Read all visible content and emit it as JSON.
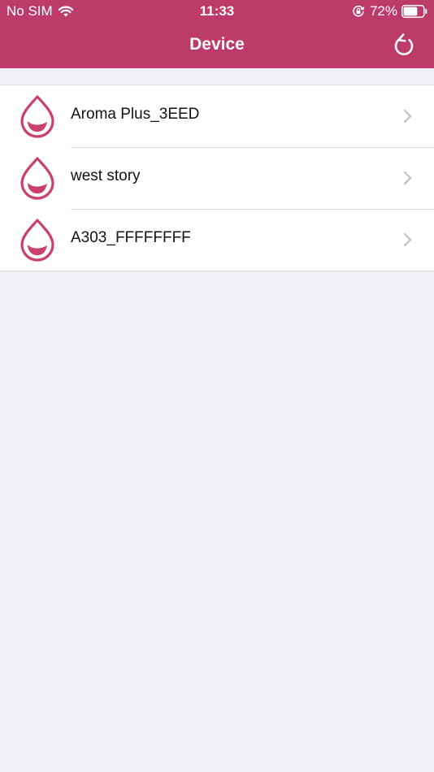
{
  "status_bar": {
    "carrier": "No SIM",
    "time": "11:33",
    "battery_percent": "72%",
    "battery_level": 0.72,
    "icons": [
      "wifi-icon",
      "orientation-lock-icon",
      "battery-icon"
    ]
  },
  "nav": {
    "title": "Device",
    "refresh_icon": "refresh-icon"
  },
  "devices": [
    {
      "name": "Aroma Plus_3EED",
      "icon": "drop-icon"
    },
    {
      "name": "west story",
      "icon": "drop-icon"
    },
    {
      "name": "A303_FFFFFFFF",
      "icon": "drop-icon"
    }
  ],
  "colors": {
    "brand": "#bd3b68",
    "background": "#f1f0f6",
    "chevron": "#c4c4c8"
  }
}
